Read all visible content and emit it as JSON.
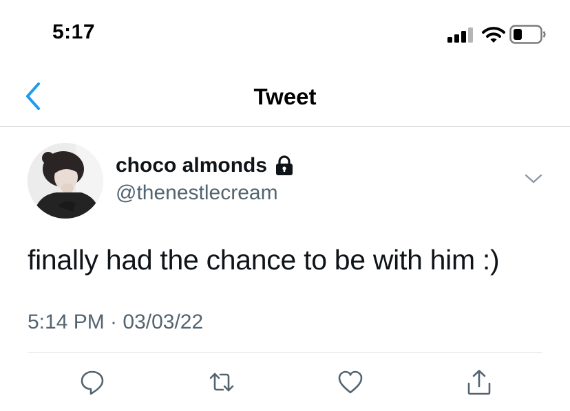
{
  "status_bar": {
    "time": "5:17"
  },
  "nav": {
    "title": "Tweet",
    "back_icon": "chevron-left-icon"
  },
  "tweet": {
    "author": {
      "display_name": "choco almonds",
      "handle": "@thenestlecream",
      "protected": true
    },
    "text": "finally had the chance to be with him :)",
    "timestamp": "5:14 PM · 03/03/22"
  },
  "actions": [
    "reply-icon",
    "retweet-icon",
    "like-icon",
    "share-icon"
  ],
  "colors": {
    "accent": "#1d9bf0",
    "secondary_text": "#536471",
    "primary_text": "#0f1419",
    "divider": "#c8c8cc"
  }
}
